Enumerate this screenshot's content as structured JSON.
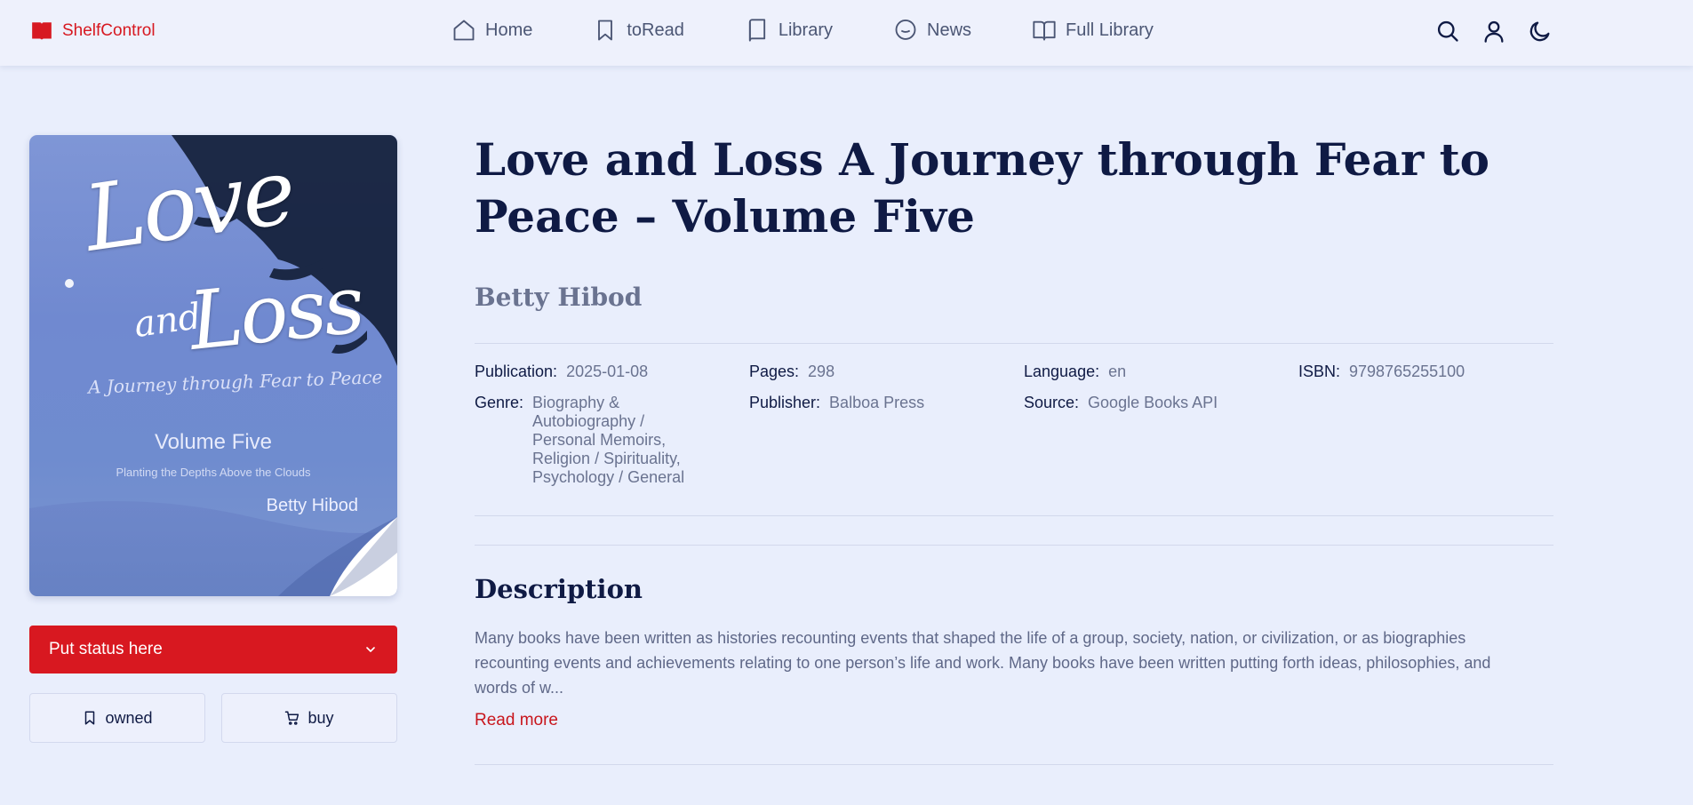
{
  "header": {
    "brand": "ShelfControl",
    "nav": [
      {
        "label": "Home",
        "icon": "home-icon"
      },
      {
        "label": "toRead",
        "icon": "bookmark-icon"
      },
      {
        "label": "Library",
        "icon": "book-icon"
      },
      {
        "label": "News",
        "icon": "chat-icon"
      },
      {
        "label": "Full Library",
        "icon": "open-book-icon"
      }
    ],
    "tools": [
      "search-icon",
      "user-icon",
      "moon-icon"
    ]
  },
  "cover": {
    "title_word1": "Love",
    "title_and": "and",
    "title_word2": "Loss",
    "subtitle": "A Journey through Fear to Peace",
    "volume": "Volume Five",
    "tagline": "Planting the Depths Above the Clouds",
    "author": "Betty Hibod"
  },
  "actions": {
    "status_label": "Put status here",
    "owned_label": "owned",
    "buy_label": "buy"
  },
  "book": {
    "title": "Love and Loss A Journey through Fear to Peace – Volume Five",
    "author": "Betty Hibod",
    "publication_label": "Publication:",
    "publication": "2025-01-08",
    "pages_label": "Pages:",
    "pages": "298",
    "language_label": "Language:",
    "language": "en",
    "isbn_label": "ISBN:",
    "isbn": "9798765255100",
    "genre_label": "Genre:",
    "genre": "Biography & Autobiography / Personal Memoirs, Religion / Spirituality, Psychology / General",
    "publisher_label": "Publisher:",
    "publisher": "Balboa Press",
    "source_label": "Source:",
    "source": "Google Books API"
  },
  "description": {
    "heading": "Description",
    "text": "Many books have been written as histories recounting events that shaped the life of a group, society, nation, or civilization, or as biographies recounting events and achievements relating to one person’s life and work. Many books have been written putting forth ideas, philosophies, and words of w...",
    "read_more": "Read more"
  },
  "colors": {
    "accent": "#d81820",
    "background": "#e9eefc",
    "text": "#0f1a44",
    "muted": "#6a7390"
  }
}
